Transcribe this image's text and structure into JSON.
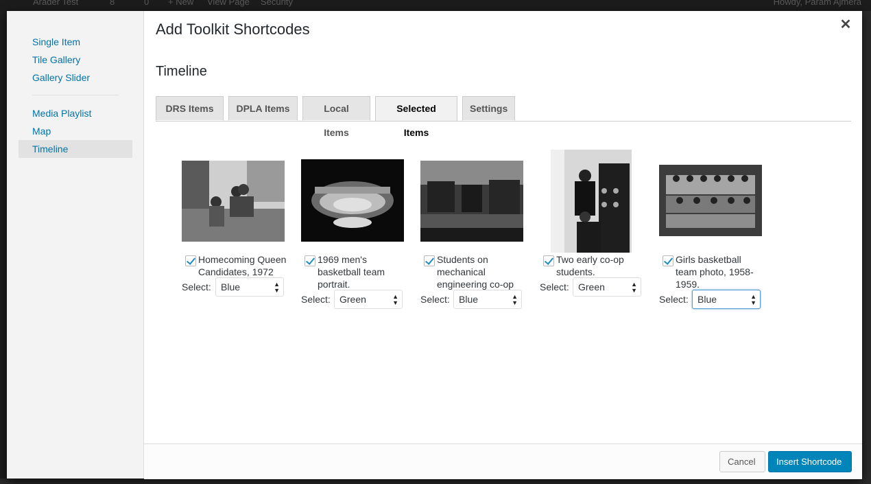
{
  "admin_bar": {
    "site_name": "Arader Test",
    "updates_count": "8",
    "comments_count": "0",
    "new_label": "+ New",
    "view_page_label": "View Page",
    "security_label": "Security",
    "howdy": "Howdy, Param Ajmera"
  },
  "modal": {
    "title": "Add Toolkit Shortcodes",
    "close_glyph": "✕",
    "section_title": "Timeline"
  },
  "sidebar": {
    "items": [
      {
        "label": "Single Item"
      },
      {
        "label": "Tile Gallery"
      },
      {
        "label": "Gallery Slider"
      },
      {
        "label": "Media Playlist"
      },
      {
        "label": "Map"
      },
      {
        "label": "Timeline"
      }
    ],
    "active_index": 5
  },
  "tabs": [
    {
      "label": "DRS Items"
    },
    {
      "label": "DPLA Items"
    },
    {
      "label": "Local Items"
    },
    {
      "label": "Selected Items"
    },
    {
      "label": "Settings"
    }
  ],
  "active_tab": "Selected Items",
  "items": [
    {
      "caption": [
        "Homecoming Queen",
        "Candidates, 1972"
      ],
      "checked": true,
      "select_label": "Select:",
      "select_value": "Blue"
    },
    {
      "caption": [
        "1969 men's",
        "basketball team",
        "portrait."
      ],
      "checked": true,
      "select_label": "Select:",
      "select_value": "Green"
    },
    {
      "caption": [
        "Students on",
        "mechanical",
        "engineering co-op"
      ],
      "checked": true,
      "select_label": "Select:",
      "select_value": "Blue"
    },
    {
      "caption": [
        "Two early co-op",
        "students."
      ],
      "checked": true,
      "select_label": "Select:",
      "select_value": "Green"
    },
    {
      "caption": [
        "Girls basketball",
        "team photo, 1958-",
        "1959."
      ],
      "checked": true,
      "select_label": "Select:",
      "select_value": "Blue"
    }
  ],
  "footer": {
    "cancel_label": "Cancel",
    "insert_label": "Insert Shortcode"
  },
  "colors": {
    "accent": "#0085ba",
    "link": "#0073aa"
  }
}
